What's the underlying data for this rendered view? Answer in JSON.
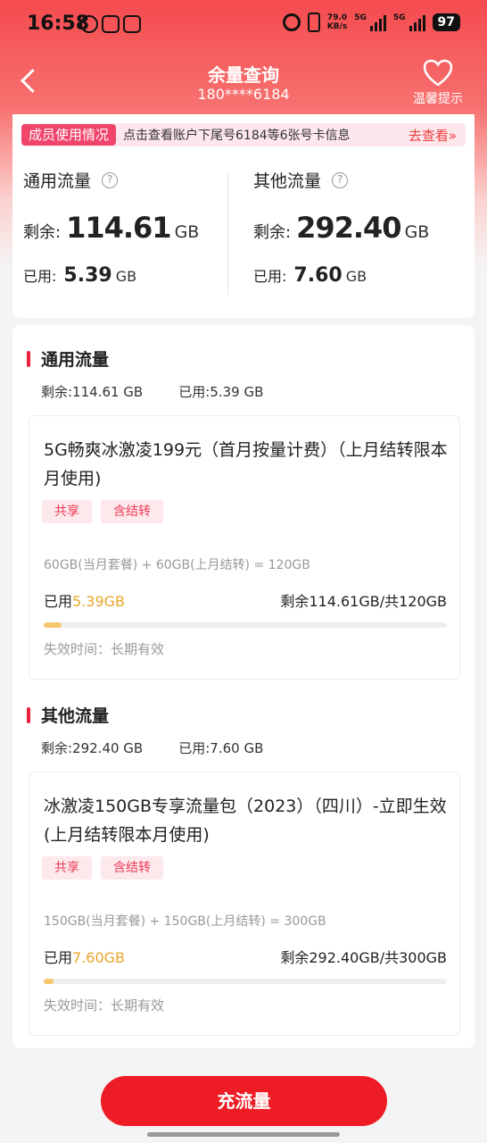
{
  "status_bar": {
    "time": "16:58",
    "net_speed_value": "79.0",
    "net_speed_unit": "KB/s",
    "sim1_type": "5G",
    "sim2_type": "5G",
    "battery": "97"
  },
  "nav": {
    "title": "余量查询",
    "phone": "180****6184",
    "tips_label": "温馨提示"
  },
  "member": {
    "tag": "成员使用情况",
    "text": "点击查看账户下尾号6184等6张号卡信息",
    "link": "去查看»"
  },
  "summary": {
    "general": {
      "title": "通用流量",
      "remain_label": "剩余:",
      "remain_value": "114.61",
      "remain_unit": "GB",
      "used_label": "已用:",
      "used_value": "5.39",
      "used_unit": "GB"
    },
    "other": {
      "title": "其他流量",
      "remain_label": "剩余:",
      "remain_value": "292.40",
      "remain_unit": "GB",
      "used_label": "已用:",
      "used_value": "7.60",
      "used_unit": "GB"
    }
  },
  "sections": [
    {
      "title": "通用流量",
      "remain": "剩余:114.61 GB",
      "used": "已用:5.39 GB",
      "package": {
        "name": "5G畅爽冰激凌199元（首月按量计费）（上月结转限本月使用)",
        "tags": [
          "共享",
          "含结转"
        ],
        "formula": "60GB(当月套餐) + 60GB(上月结转) = 120GB",
        "used_prefix": "已用",
        "used_value": "5.39GB",
        "remain_total": "剩余114.61GB/共120GB",
        "progress": 0.045,
        "expire": "失效时间：长期有效"
      }
    },
    {
      "title": "其他流量",
      "remain": "剩余:292.40 GB",
      "used": "已用:7.60 GB",
      "package": {
        "name": "冰激凌150GB专享流量包（2023）（四川）-立即生效 (上月结转限本月使用)",
        "tags": [
          "共享",
          "含结转"
        ],
        "formula": "150GB(当月套餐) + 150GB(上月结转) = 300GB",
        "used_prefix": "已用",
        "used_value": "7.60GB",
        "remain_total": "剩余292.40GB/共300GB",
        "progress": 0.025,
        "expire": "失效时间：长期有效"
      }
    }
  ],
  "recharge_button": "充流量",
  "colors": {
    "brand_red": "#ee1c25",
    "gold": "#e8a52a",
    "tag_pink": "#f0446a"
  }
}
